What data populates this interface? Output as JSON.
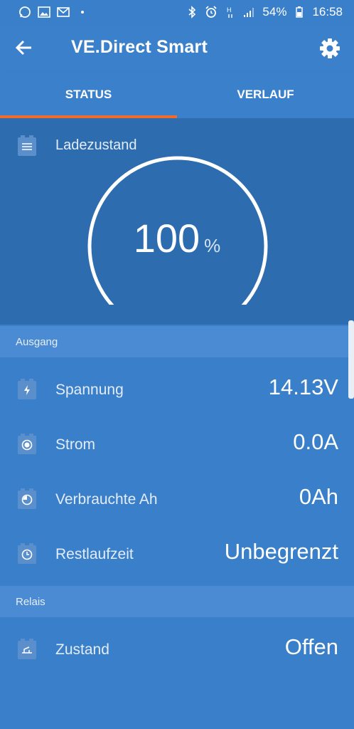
{
  "statusbar": {
    "battery_pct": "54%",
    "time": "16:58",
    "left_icons": [
      "whatsapp-icon",
      "image-icon",
      "mail-icon"
    ],
    "right_icons": [
      "bluetooth-icon",
      "alarm-icon",
      "hplus-signal-icon",
      "signal-icon",
      "battery-icon"
    ]
  },
  "appbar": {
    "title": "VE.Direct Smart"
  },
  "tabs": [
    {
      "label": "STATUS",
      "active": true
    },
    {
      "label": "VERLAUF",
      "active": false
    }
  ],
  "soc": {
    "label": "Ladezustand",
    "value": "100",
    "unit": "%",
    "gauge_level": 1.0
  },
  "sections": {
    "ausgang": {
      "header": "Ausgang",
      "rows": [
        {
          "label": "Spannung",
          "value": "14.13V",
          "icon": "lightning-icon"
        },
        {
          "label": "Strom",
          "value": "0.0A",
          "icon": "current-icon"
        },
        {
          "label": "Verbrauchte Ah",
          "value": "0Ah",
          "icon": "consumed-icon"
        },
        {
          "label": "Restlaufzeit",
          "value": "Unbegrenzt",
          "icon": "clock-icon"
        }
      ]
    },
    "relais": {
      "header": "Relais",
      "rows": [
        {
          "label": "Zustand",
          "value": "Offen",
          "icon": "relay-icon"
        }
      ]
    }
  },
  "colors": {
    "background": "#3a7fc9",
    "panel": "#2d6cae",
    "section_header": "#4a8bd3",
    "tab_indicator": "#ef6c2a"
  }
}
